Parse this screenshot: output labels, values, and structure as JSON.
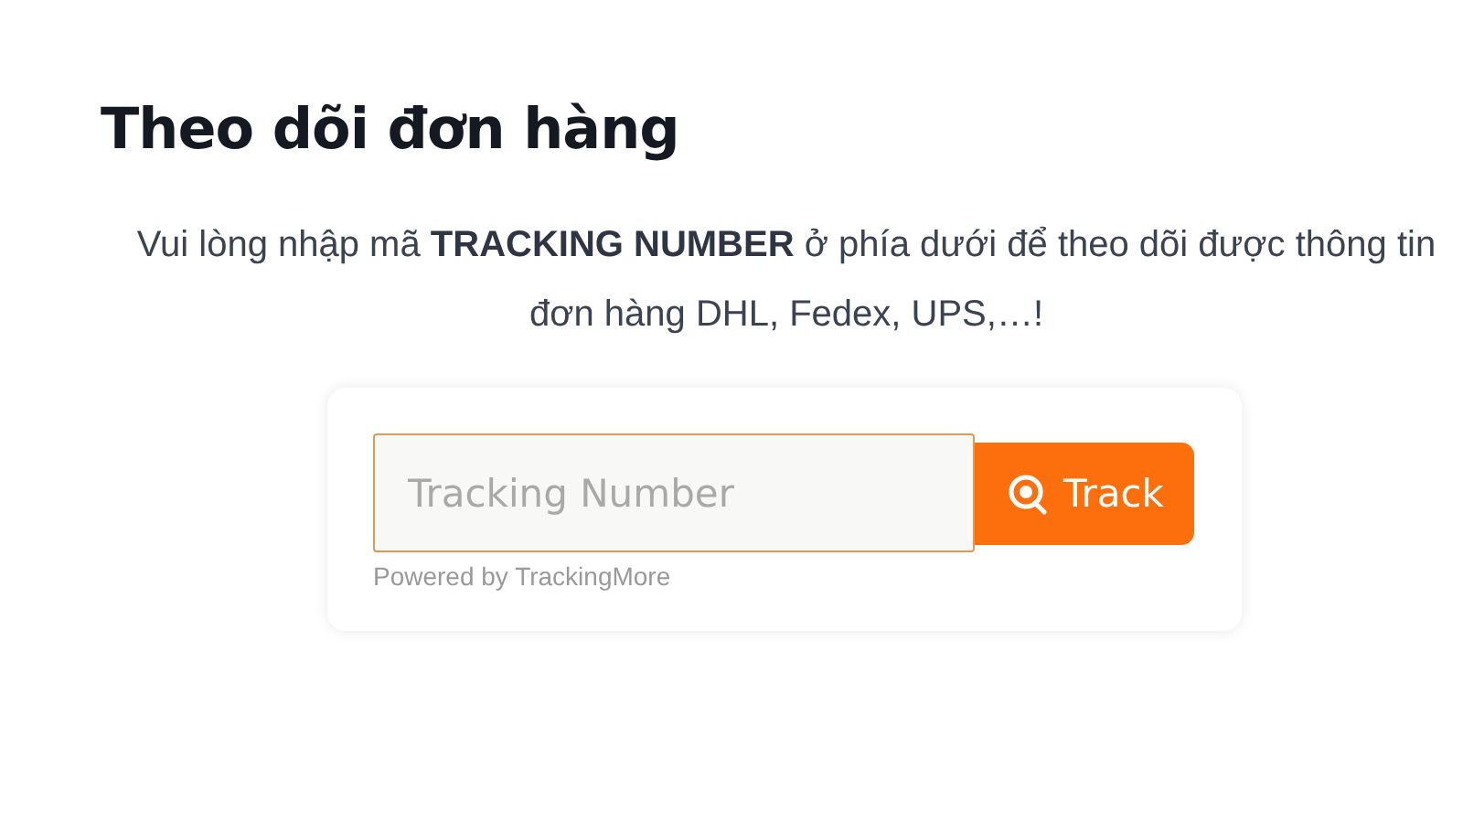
{
  "heading": "Theo dõi đơn hàng",
  "intro": "Vui lòng nhập mã **TRACKING NUMBER** ở phía dưới để theo dõi được thông tin đơn hàng DHL, Fedex, UPS,…!",
  "tracker": {
    "placeholder": "Tracking Number",
    "button": "Track",
    "credit": "Powered by TrackingMore"
  }
}
